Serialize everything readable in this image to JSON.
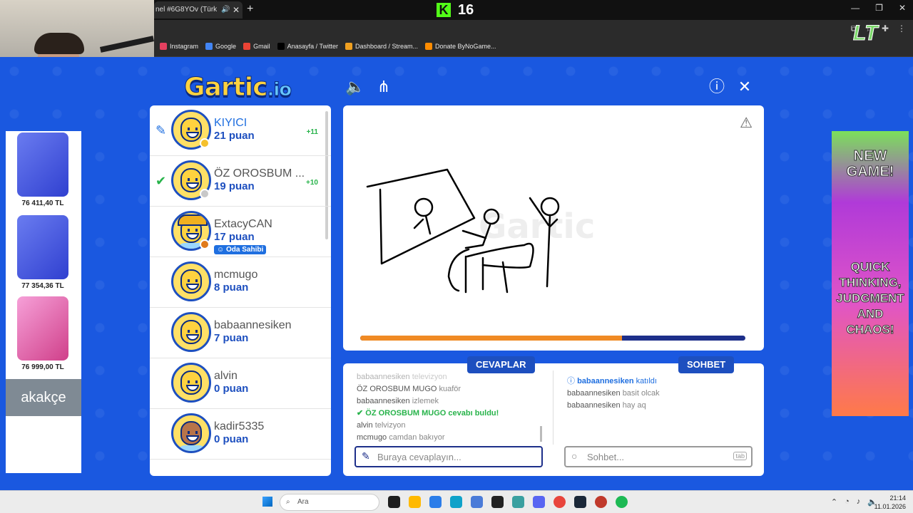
{
  "browser": {
    "tab_title": "nel #6G8YOv (Türkçe) - (",
    "kick_count": "16",
    "bookmarks": [
      "Instagram",
      "Google",
      "Gmail",
      "Anasayfa / Twitter",
      "Dashboard / Stream...",
      "Donate ByNoGame..."
    ]
  },
  "game": {
    "logo_main": "Gartic",
    "logo_suffix": ".io",
    "progress_fraction": 0.68,
    "players": [
      {
        "name": "KIYICI",
        "points": "21 puan",
        "increment": "+11",
        "mark": "pencil",
        "status_color": "#f5c12e",
        "highlight": true
      },
      {
        "name": "ÖZ OROSBUM ...",
        "points": "19 puan",
        "increment": "+10",
        "mark": "check",
        "status_color": "#c8c8c8",
        "highlight": false
      },
      {
        "name": "ExtacyCAN",
        "points": "17 puan",
        "increment": "",
        "mark": "",
        "status_color": "#e07a1a",
        "highlight": false,
        "badge": "Oda Sahibi"
      },
      {
        "name": "mcmugo",
        "points": "8 puan",
        "increment": "",
        "mark": "",
        "status_color": "",
        "highlight": false
      },
      {
        "name": "babaannesiken",
        "points": "7 puan",
        "increment": "",
        "mark": "",
        "status_color": "",
        "highlight": false
      },
      {
        "name": "alvin",
        "points": "0 puan",
        "increment": "",
        "mark": "",
        "status_color": "",
        "highlight": false
      },
      {
        "name": "kadir5335",
        "points": "0 puan",
        "increment": "",
        "mark": "",
        "status_color": "",
        "highlight": false
      }
    ],
    "answers_label": "CEVAPLAR",
    "chat_label": "SOHBET",
    "answers": [
      {
        "user": "babaannesiken",
        "text": "televizyon",
        "type": "faded"
      },
      {
        "user": "ÖZ OROSBUM MUGO",
        "text": "kuaför",
        "type": "normal"
      },
      {
        "user": "babaannesiken",
        "text": "izlemek",
        "type": "normal"
      },
      {
        "user": "ÖZ OROSBUM MUGO",
        "text": "cevabı buldu!",
        "type": "hit"
      },
      {
        "user": "alvin",
        "text": "telvizyon",
        "type": "normal"
      },
      {
        "user": "mcmugo",
        "text": "camdan bakıyor",
        "type": "normal"
      }
    ],
    "chat": [
      {
        "user": "babaannesiken",
        "text": "katıldı",
        "type": "join"
      },
      {
        "user": "babaannesiken",
        "text": "basit olcak",
        "type": "normal"
      },
      {
        "user": "babaannesiken",
        "text": "hay aq",
        "type": "normal"
      }
    ],
    "answer_placeholder": "Buraya cevaplayın...",
    "chat_placeholder": "Sohbet...",
    "tab_key": "tab",
    "owner_badge": "Oda Sahibi"
  },
  "ads": {
    "prices": [
      "76 411,40 TL",
      "77 354,36 TL",
      "76 999,00 TL"
    ],
    "akakce": "akakçe",
    "right_top": "NEW GAME!",
    "right_bottom": "QUICK THINKING, JUDGMENT AND CHAOS!"
  },
  "taskbar": {
    "search": "Ara",
    "time": "21:14",
    "date": "11.01.2026"
  }
}
